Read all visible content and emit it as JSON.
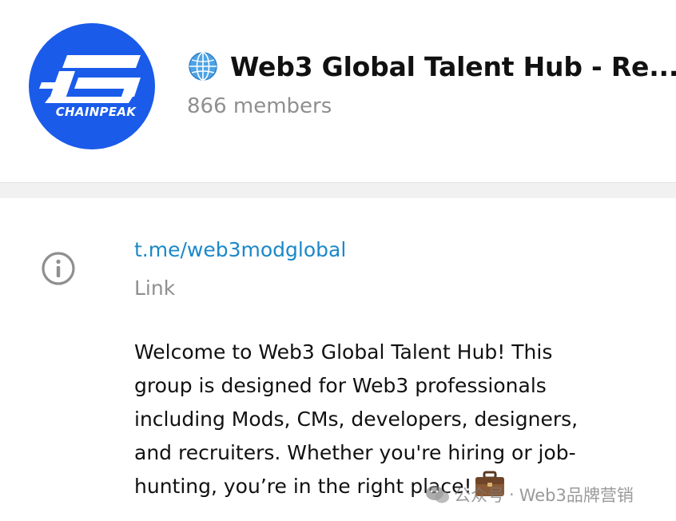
{
  "header": {
    "avatar_text": "CHAINPEAK",
    "title_icon": "globe-icon",
    "title": "Web3 Global Talent Hub - Re...",
    "members": "866 members"
  },
  "info": {
    "icon": "info-icon",
    "link": "t.me/web3modglobal",
    "link_caption": "Link",
    "description_lines": [
      "Welcome to Web3 Global Talent Hub! This",
      "group is designed for Web3 professionals",
      "including Mods, CMs, developers, designers,",
      "and recruiters. Whether you're hiring or job-",
      "hunting, you’re in the right place!"
    ],
    "description_emoji": "briefcase-icon"
  },
  "watermark": {
    "prefix": "公众号",
    "separator": "·",
    "name": "Web3品牌营销"
  },
  "colors": {
    "avatar_bg": "#1a5bea",
    "link": "#1b88c9",
    "muted": "#8f8f8f"
  }
}
